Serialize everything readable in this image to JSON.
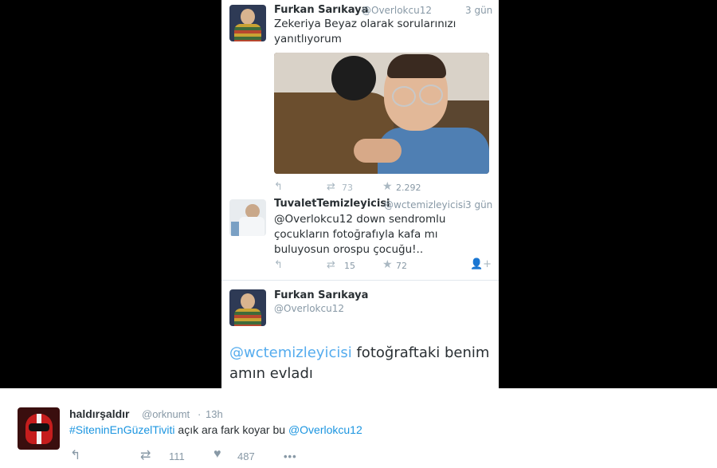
{
  "screenshot": {
    "tweet1": {
      "name": "Furkan Sarıkaya",
      "handle": "@Overlokcu12",
      "time": "3 gün",
      "text": "Zekeriya Beyaz olarak sorularınızı yanıtlıyorum",
      "retweets": "73",
      "likes": "2.292"
    },
    "tweet2": {
      "name": "TuvaletTemizleyicisi",
      "handle": "@wctemizleyicisi",
      "time": "3 gün",
      "text": "@Overlokcu12 down sendromlu çocukların fotoğrafıyla kafa mı buluyosun orospu çocuğu!..",
      "retweets": "15",
      "likes": "72"
    },
    "tweet3": {
      "name": "Furkan Sarıkaya",
      "handle": "@Overlokcu12",
      "mention": "@wctemizleyicisi",
      "text_rest": " fotoğraftaki benim amın evladı"
    }
  },
  "tweet": {
    "name": "haldırşaldır",
    "handle": "@orknumt",
    "separator": "·",
    "time": "13h",
    "hashtag": "#SiteninEnGüzelTiviti",
    "text_middle": " açık ara fark koyar bu ",
    "mention": "@Overlokcu12",
    "retweets": "111",
    "likes": "487",
    "more": "•••"
  },
  "icons": {
    "reply": "reply-arrow-icon",
    "retweet": "retweet-icon",
    "like_star": "star-icon",
    "like_heart": "heart-icon",
    "follow": "follow-user-icon",
    "more": "more-dots-icon"
  },
  "colors": {
    "link": "#1b95e0",
    "mention_light": "#55acee",
    "muted": "#8899a6",
    "text": "#292f33"
  }
}
